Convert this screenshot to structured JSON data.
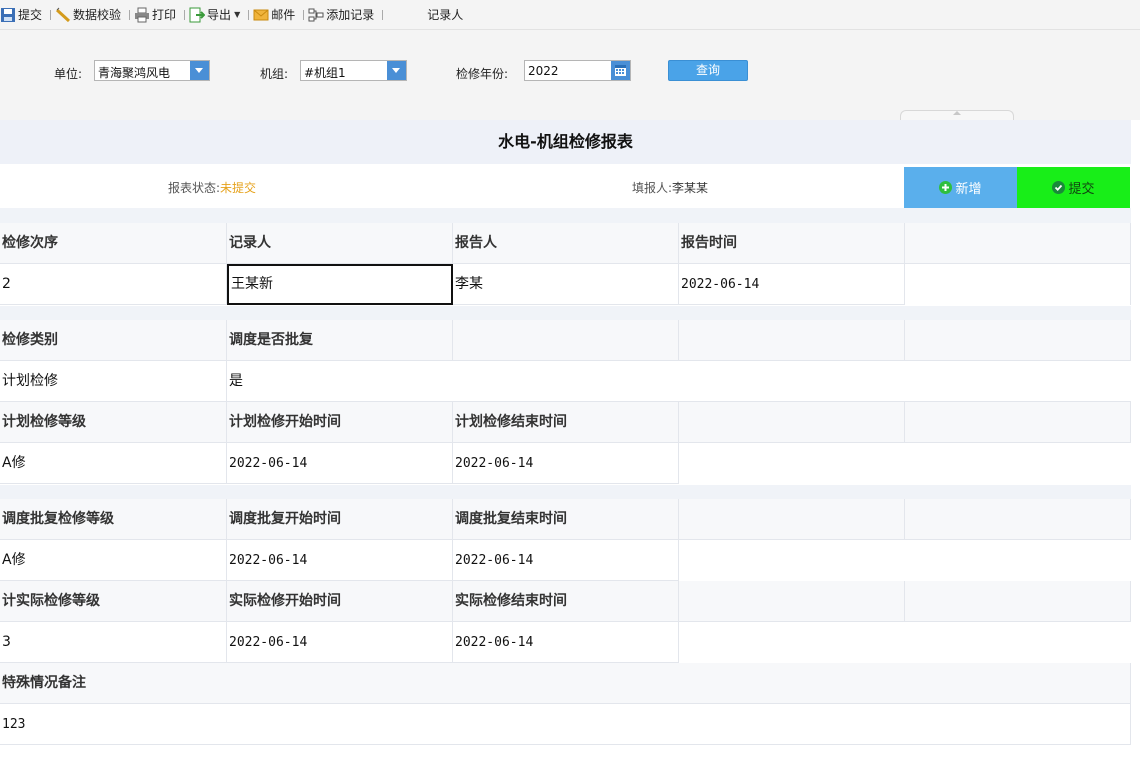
{
  "toolbar": {
    "submit": "提交",
    "validate": "数据校验",
    "print": "打印",
    "export": "导出",
    "mail": "邮件",
    "add_record": "添加记录",
    "recorder": "记录人"
  },
  "filter": {
    "unit_label": "单位:",
    "unit_value": "青海聚鸿风电",
    "group_label": "机组:",
    "group_value": "#机组1",
    "year_label": "检修年份:",
    "year_value": "2022",
    "query_button": "查询"
  },
  "report": {
    "title": "水电-机组检修报表",
    "status_label": "报表状态:",
    "status_value": "未提交",
    "reporter_label": "填报人:",
    "reporter_value": "李某某",
    "add_button": "新增",
    "submit_button": "提交"
  },
  "section1": {
    "headers": [
      "检修次序",
      "记录人",
      "报告人",
      "报告时间"
    ],
    "values": [
      "2",
      "王某新",
      "李某",
      "2022-06-14"
    ]
  },
  "section2": {
    "headers": [
      "检修类别",
      "调度是否批复"
    ],
    "values": [
      "计划检修",
      "是"
    ],
    "plan_headers": [
      "计划检修等级",
      "计划检修开始时间",
      "计划检修结束时间"
    ],
    "plan_values": [
      "A修",
      "2022-06-14",
      "2022-06-14"
    ]
  },
  "section3": {
    "dispatch_headers": [
      "调度批复检修等级",
      "调度批复开始时间",
      "调度批复结束时间"
    ],
    "dispatch_values": [
      "A修",
      "2022-06-14",
      "2022-06-14"
    ],
    "actual_headers": [
      "计实际检修等级",
      "实际检修开始时间",
      "实际检修结束时间"
    ],
    "actual_values": [
      "3",
      "2022-06-14",
      "2022-06-14"
    ],
    "remark_header": "特殊情况备注",
    "remark_value": "123"
  },
  "colors": {
    "accent_blue": "#4aa3e8",
    "add_button": "#5aafec",
    "submit_button": "#18ee18",
    "status_orange": "#e6a21c"
  }
}
